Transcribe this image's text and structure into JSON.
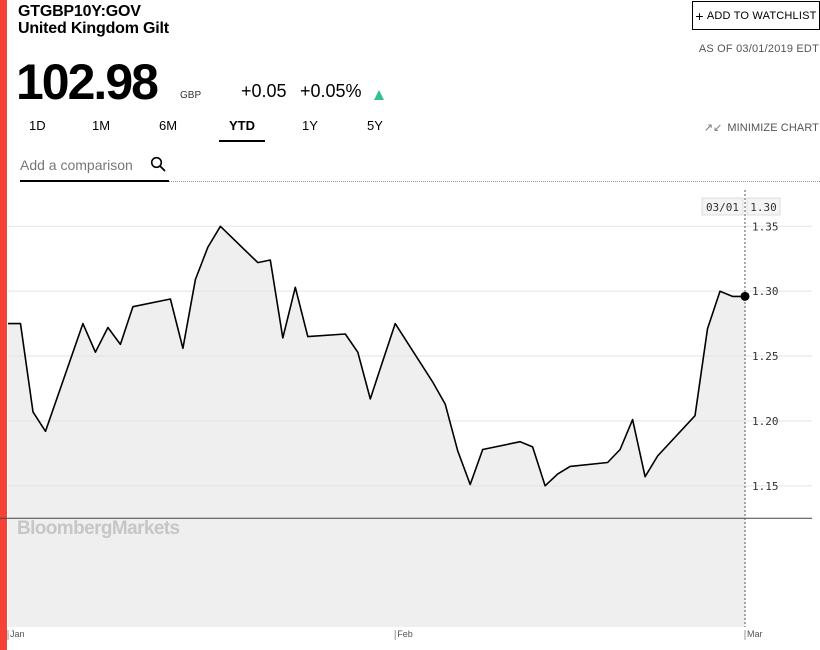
{
  "header": {
    "ticker": "GTGBP10Y:GOV",
    "name": "United Kingdom Gilt",
    "watchlist_label": "ADD TO WATCHLIST",
    "as_of": "AS OF 03/01/2019 EDT"
  },
  "quote": {
    "price": "102.98",
    "currency": "GBP",
    "change": "+0.05",
    "change_pct": "+0.05%"
  },
  "tabs": [
    {
      "label": "1D"
    },
    {
      "label": "1M"
    },
    {
      "label": "6M"
    },
    {
      "label": "YTD"
    },
    {
      "label": "1Y"
    },
    {
      "label": "5Y"
    }
  ],
  "active_tab": "YTD",
  "minimize_label": "MINIMIZE CHART",
  "comparison": {
    "placeholder": "Add a comparison"
  },
  "watermark": "BloombergMarkets",
  "colors": {
    "accent": "#f44336",
    "up": "#33c191",
    "line": "#000000",
    "area_fill": "#efefef",
    "grid": "#e3e3e3"
  },
  "icons": {
    "search": "search-icon",
    "minimize": "minimize-arrows-icon",
    "plus": "plus-icon",
    "up_arrow": "up-triangle-icon"
  },
  "chart_data": {
    "type": "area",
    "x_tick_labels": [
      "Jan",
      "Feb",
      "Mar"
    ],
    "y_tick_labels": [
      "1.15",
      "1.20",
      "1.25",
      "1.30",
      "1.35"
    ],
    "ylim": [
      1.075,
      1.4
    ],
    "y_ticks": [
      1.15,
      1.2,
      1.25,
      1.3,
      1.35
    ],
    "grid": true,
    "crosshair_date_label": "03/01",
    "crosshair_value_label": "1.30",
    "series": [
      {
        "x": [
          "2019-01-01",
          "2019-01-02",
          "2019-01-03",
          "2019-01-04",
          "2019-01-07",
          "2019-01-08",
          "2019-01-09",
          "2019-01-10",
          "2019-01-11",
          "2019-01-14",
          "2019-01-15",
          "2019-01-16",
          "2019-01-17",
          "2019-01-18",
          "2019-01-21",
          "2019-01-22",
          "2019-01-23",
          "2019-01-24",
          "2019-01-25",
          "2019-01-28",
          "2019-01-29",
          "2019-01-30",
          "2019-01-31",
          "2019-02-01",
          "2019-02-04",
          "2019-02-05",
          "2019-02-06",
          "2019-02-07",
          "2019-02-08",
          "2019-02-11",
          "2019-02-12",
          "2019-02-13",
          "2019-02-14",
          "2019-02-15",
          "2019-02-18",
          "2019-02-19",
          "2019-02-20",
          "2019-02-21",
          "2019-02-22",
          "2019-02-25",
          "2019-02-26",
          "2019-02-27",
          "2019-02-28",
          "2019-03-01"
        ],
        "values": [
          1.275,
          1.275,
          1.207,
          1.192,
          1.275,
          1.253,
          1.272,
          1.259,
          1.288,
          1.294,
          1.256,
          1.309,
          1.334,
          1.35,
          1.322,
          1.324,
          1.264,
          1.303,
          1.265,
          1.267,
          1.253,
          1.217,
          1.246,
          1.275,
          1.23,
          1.213,
          1.177,
          1.151,
          1.178,
          1.184,
          1.18,
          1.15,
          1.159,
          1.165,
          1.168,
          1.178,
          1.201,
          1.157,
          1.173,
          1.204,
          1.271,
          1.3,
          1.296,
          1.296
        ]
      }
    ]
  }
}
